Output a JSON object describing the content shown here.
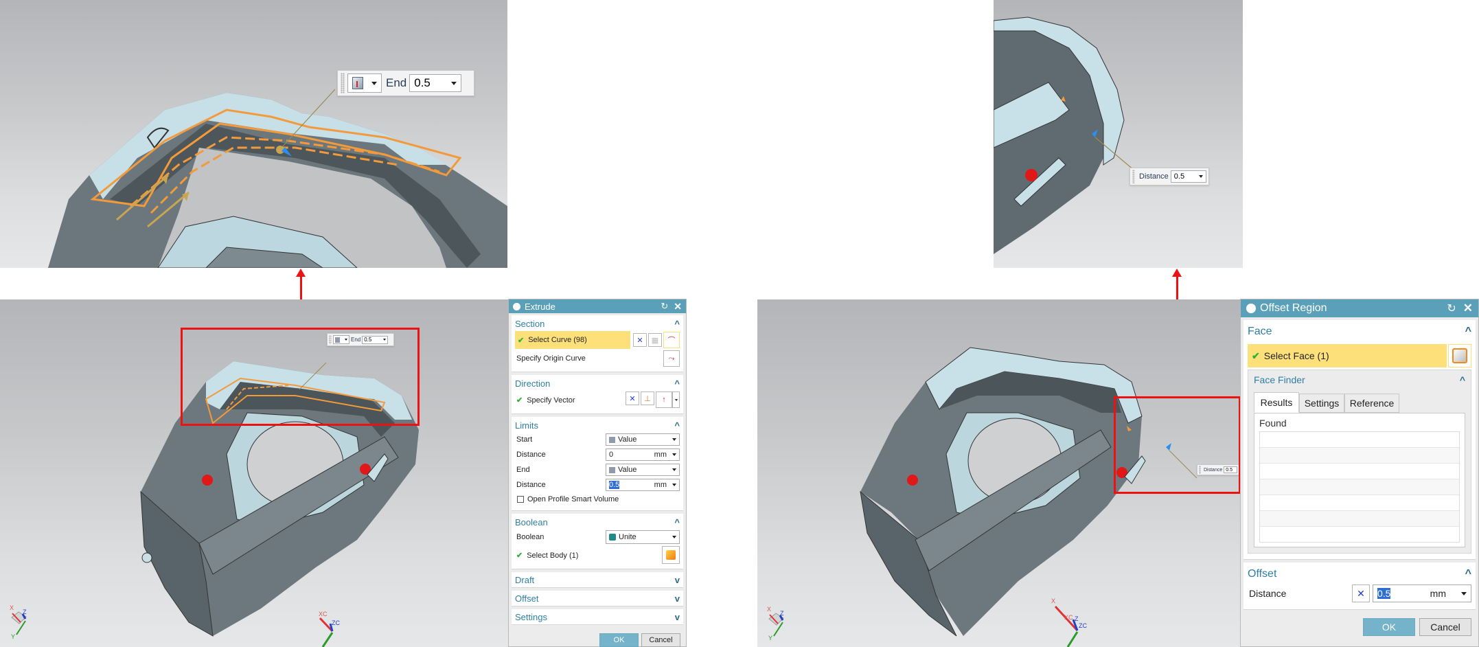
{
  "left_panel": {
    "zoom_handle": {
      "end_label": "End",
      "end_value": "0.5",
      "icon": "value-cube-icon"
    },
    "main_handle": {
      "end_label": "End",
      "end_value": "0.5",
      "icon": "value-cube-icon"
    },
    "triad_labels": {
      "x": "X",
      "y": "Y",
      "z": "Z"
    },
    "wcs_labels": {
      "xc": "XC",
      "zc": "ZC"
    },
    "extrude_dialog": {
      "title": "Extrude",
      "reset_icon": "reset-icon",
      "close_icon": "close-icon",
      "section": {
        "header": "Section",
        "select_curve": "Select Curve (98)",
        "specify_origin_curve": "Specify Origin Curve"
      },
      "direction": {
        "header": "Direction",
        "specify_vector": "Specify Vector"
      },
      "limits": {
        "header": "Limits",
        "start_label": "Start",
        "start_value": "Value",
        "start_distance_label": "Distance",
        "start_distance_value": "0",
        "start_distance_unit": "mm",
        "end_label": "End",
        "end_value": "Value",
        "end_distance_label": "Distance",
        "end_distance_value": "0.5",
        "end_distance_unit": "mm",
        "open_profile_label": "Open Profile Smart Volume",
        "open_profile_checked": false
      },
      "boolean": {
        "header": "Boolean",
        "boolean_label": "Boolean",
        "boolean_value": "Unite",
        "select_body": "Select Body (1)"
      },
      "draft_header": "Draft",
      "offset_header": "Offset",
      "settings_header": "Settings",
      "ok_label": "OK",
      "cancel_label": "Cancel"
    }
  },
  "right_panel": {
    "zoom_handle": {
      "label": "Distance",
      "value": "0.5"
    },
    "main_handle": {
      "label": "Distance",
      "value": "0.5"
    },
    "triad_labels": {
      "x": "X",
      "y": "Y",
      "z": "Z"
    },
    "wcs_labels": {
      "x": "X",
      "xc": "XC",
      "z": "Z",
      "zc": "ZC"
    },
    "offset_region_dialog": {
      "title": "Offset Region",
      "face": {
        "header": "Face",
        "select_face": "Select Face (1)",
        "face_finder": {
          "header": "Face Finder",
          "tabs": [
            "Results",
            "Settings",
            "Reference"
          ],
          "active_tab": "Results",
          "found_label": "Found",
          "found_rows": [
            "",
            "",
            "",
            "",
            "",
            "",
            ""
          ]
        }
      },
      "offset": {
        "header": "Offset",
        "distance_label": "Distance",
        "distance_value": "0.5",
        "distance_unit": "mm"
      },
      "ok_label": "OK",
      "cancel_label": "Cancel"
    }
  },
  "colors": {
    "dialog_title_bar": "#5aa0b9",
    "section_header_text": "#2f7fa3",
    "selection_highlight": "#fde07a",
    "annotation_red": "#ee1111",
    "curve_orange": "#f39a3b",
    "part_dark": "#5f6c72",
    "part_light": "#c9e3ea"
  }
}
